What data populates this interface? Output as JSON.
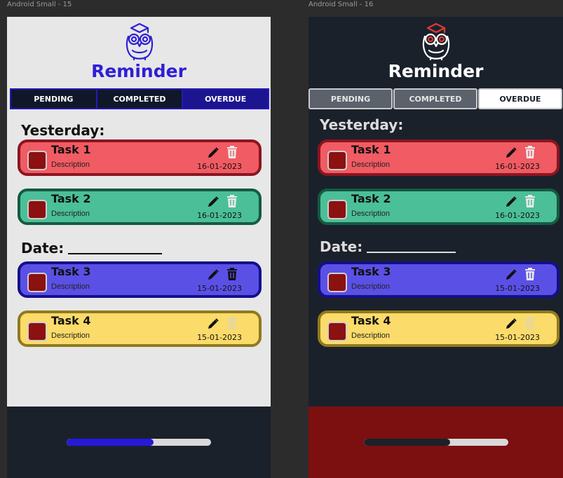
{
  "screens": [
    {
      "frame_label": "Android Small - 15",
      "theme": "light",
      "app_title": "Reminder",
      "owl_color": "#2e1fd6",
      "tabs": [
        {
          "label": "PENDING",
          "active": false
        },
        {
          "label": "COMPLETED",
          "active": false
        },
        {
          "label": "OVERDUE",
          "active": true
        }
      ],
      "sections": [
        {
          "label": "Yesterday:"
        },
        {
          "label": "Date:"
        }
      ],
      "tasks": [
        {
          "name": "Task 1",
          "description": "Description",
          "date": "16-01-2023",
          "fill": "#f15b63",
          "border": "#8b1520",
          "trash_color": "#e8e8e8"
        },
        {
          "name": "Task 2",
          "description": "Description",
          "date": "16-01-2023",
          "fill": "#4bbf98",
          "border": "#155a41",
          "trash_color": "#e8e8e8"
        },
        {
          "name": "Task 3",
          "description": "Description",
          "date": "15-01-2023",
          "fill": "#5b50e6",
          "border": "#140f8a",
          "trash_color": "#e8e8e8"
        },
        {
          "name": "Task 4",
          "description": "Description",
          "date": "15-01-2023",
          "fill": "#fbdb6a",
          "border": "#8f7a1f",
          "trash_color": "#d9d9d9"
        }
      ],
      "progress": 0.6
    },
    {
      "frame_label": "Android Small - 16",
      "theme": "dark",
      "app_title": "Reminder",
      "owl_color": "#e53935",
      "tabs": [
        {
          "label": "PENDING",
          "active": false
        },
        {
          "label": "COMPLETED",
          "active": false
        },
        {
          "label": "OVERDUE",
          "active": true
        }
      ],
      "sections": [
        {
          "label": "Yesterday:"
        },
        {
          "label": "Date:"
        }
      ],
      "tasks": [
        {
          "name": "Task 1",
          "description": "Description",
          "date": "16-01-2023",
          "fill": "#f15b63",
          "border": "#8b1520",
          "trash_color": "#e8e8e8"
        },
        {
          "name": "Task 2",
          "description": "Description",
          "date": "16-01-2023",
          "fill": "#4bbf98",
          "border": "#155a41",
          "trash_color": "#e8e8e8"
        },
        {
          "name": "Task 3",
          "description": "Description",
          "date": "15-01-2023",
          "fill": "#5b50e6",
          "border": "#140f8a",
          "trash_color": "#e8e8e8"
        },
        {
          "name": "Task 4",
          "description": "Description",
          "date": "15-01-2023",
          "fill": "#fbdb6a",
          "border": "#8f7a1f",
          "trash_color": "#d9d9d9"
        }
      ],
      "progress": 0.6
    }
  ]
}
